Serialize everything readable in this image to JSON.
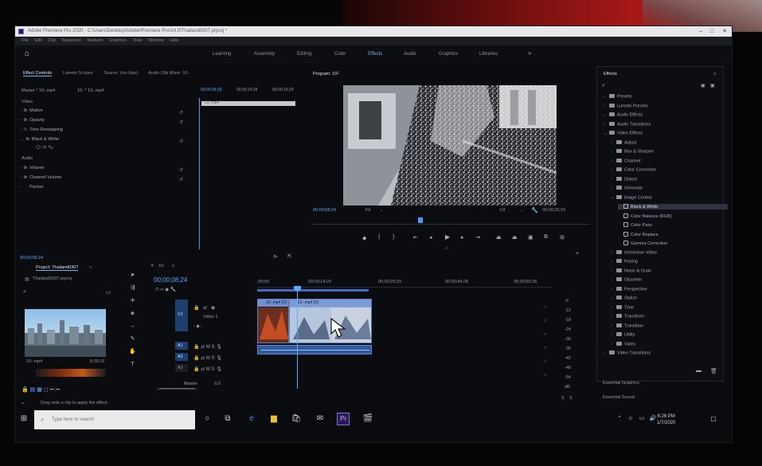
{
  "window": {
    "title": "Adobe Premiere Pro 2020 - C:\\Users\\Desktop\\Adobe\\Premiere Pro\\14.0\\Thailand0307.prproj *",
    "menu": [
      "File",
      "Edit",
      "Clip",
      "Sequence",
      "Markers",
      "Graphics",
      "View",
      "Window",
      "Help"
    ]
  },
  "workspaces": {
    "tabs": [
      "Learning",
      "Assembly",
      "Editing",
      "Color",
      "Effects",
      "Audio",
      "Graphics",
      "Libraries"
    ],
    "active": "Effects",
    "more": "»"
  },
  "source_panel": {
    "tabs": [
      "Effect Controls",
      "Lumetri Scopes",
      "Source: (no clips)",
      "Audio Clip Mixer: 10-"
    ],
    "clip_master": "Master * 10-.mp4",
    "clip_seq": "10- * 10-.mp4",
    "groups": {
      "video": "Video",
      "audio": "Audio"
    },
    "video_fx": [
      "Motion",
      "Opacity",
      "Time Remapping",
      "Black & White"
    ],
    "audio_fx": [
      "Volume",
      "Channel Volume",
      "Panner"
    ],
    "mini_times": [
      "00;00;09;29",
      "00;00;14;29",
      "00;00;19;29"
    ],
    "clip_label": "10-.mp4",
    "timecode": "00;00;08;24"
  },
  "program_monitor": {
    "title": "Program: 10-",
    "timecode": "00;00;08;24",
    "fit": "Fit",
    "quality": "1/2",
    "duration": "00;00;25;15"
  },
  "project": {
    "tabs": [
      "Project: Thailand0307",
      "»"
    ],
    "file": "Thailand0307.prproj",
    "thumb_name": "10-.mp4",
    "thumb_dur": "5;03;16"
  },
  "timeline": {
    "sequence": "10-",
    "timecode": "00;00;08;24",
    "ruler": [
      ";00;00",
      "00;00;14;29",
      "00;00;29;29",
      "00;00;44;28",
      "00;00;59;28"
    ],
    "video_track": "Video 1",
    "v1": "V1",
    "a1": "A1",
    "a2": "A2",
    "a3": "A3",
    "master": "Master",
    "master_val": "0.0",
    "clip1": "10-.mp4 [V]",
    "clip2": "10-.mp4 [V]",
    "vu_scale": [
      "-6",
      "-12",
      "-18",
      "-24",
      "-30",
      "-36",
      "-42",
      "-48",
      "-54",
      "dB"
    ],
    "vu_solo": [
      "S",
      "S"
    ]
  },
  "effects_panel": {
    "title": "Effects",
    "tree": [
      {
        "label": "Presets",
        "depth": 0,
        "kind": "folder",
        "open": false
      },
      {
        "label": "Lumetri Presets",
        "depth": 0,
        "kind": "folder",
        "open": false
      },
      {
        "label": "Audio Effects",
        "depth": 0,
        "kind": "folder",
        "open": false
      },
      {
        "label": "Audio Transitions",
        "depth": 0,
        "kind": "folder",
        "open": false
      },
      {
        "label": "Video Effects",
        "depth": 0,
        "kind": "folder",
        "open": true
      },
      {
        "label": "Adjust",
        "depth": 1,
        "kind": "folder",
        "open": false
      },
      {
        "label": "Blur & Sharpen",
        "depth": 1,
        "kind": "folder",
        "open": false
      },
      {
        "label": "Channel",
        "depth": 1,
        "kind": "folder",
        "open": false
      },
      {
        "label": "Color Correction",
        "depth": 1,
        "kind": "folder",
        "open": false
      },
      {
        "label": "Distort",
        "depth": 1,
        "kind": "folder",
        "open": false
      },
      {
        "label": "Generate",
        "depth": 1,
        "kind": "folder",
        "open": false
      },
      {
        "label": "Image Control",
        "depth": 1,
        "kind": "folder",
        "open": true
      },
      {
        "label": "Black & White",
        "depth": 2,
        "kind": "fx",
        "selected": true
      },
      {
        "label": "Color Balance (RGB)",
        "depth": 2,
        "kind": "fx"
      },
      {
        "label": "Color Pass",
        "depth": 2,
        "kind": "fx"
      },
      {
        "label": "Color Replace",
        "depth": 2,
        "kind": "fx"
      },
      {
        "label": "Gamma Correction",
        "depth": 2,
        "kind": "fx"
      },
      {
        "label": "Immersive Video",
        "depth": 1,
        "kind": "folder",
        "open": false
      },
      {
        "label": "Keying",
        "depth": 1,
        "kind": "folder",
        "open": false
      },
      {
        "label": "Noise & Grain",
        "depth": 1,
        "kind": "folder",
        "open": false
      },
      {
        "label": "Obsolete",
        "depth": 1,
        "kind": "folder",
        "open": false
      },
      {
        "label": "Perspective",
        "depth": 1,
        "kind": "folder",
        "open": false
      },
      {
        "label": "Stylize",
        "depth": 1,
        "kind": "folder",
        "open": false
      },
      {
        "label": "Time",
        "depth": 1,
        "kind": "folder",
        "open": false
      },
      {
        "label": "Transform",
        "depth": 1,
        "kind": "folder",
        "open": false
      },
      {
        "label": "Transition",
        "depth": 1,
        "kind": "folder",
        "open": false
      },
      {
        "label": "Utility",
        "depth": 1,
        "kind": "folder",
        "open": false
      },
      {
        "label": "Video",
        "depth": 1,
        "kind": "folder",
        "open": false
      },
      {
        "label": "Video Transitions",
        "depth": 0,
        "kind": "folder",
        "open": false
      }
    ],
    "extra": [
      "Essential Graphics",
      "Essential Sound"
    ]
  },
  "status": {
    "message": "Drop onto a clip to apply the effect."
  },
  "taskbar": {
    "search_placeholder": "Type here to search",
    "time": "6:26 PM",
    "date": "1/7/2020"
  },
  "colors": {
    "accent": "#4aa3ff",
    "clip": "#6e8fd0",
    "playhead": "#5aa9ff"
  }
}
